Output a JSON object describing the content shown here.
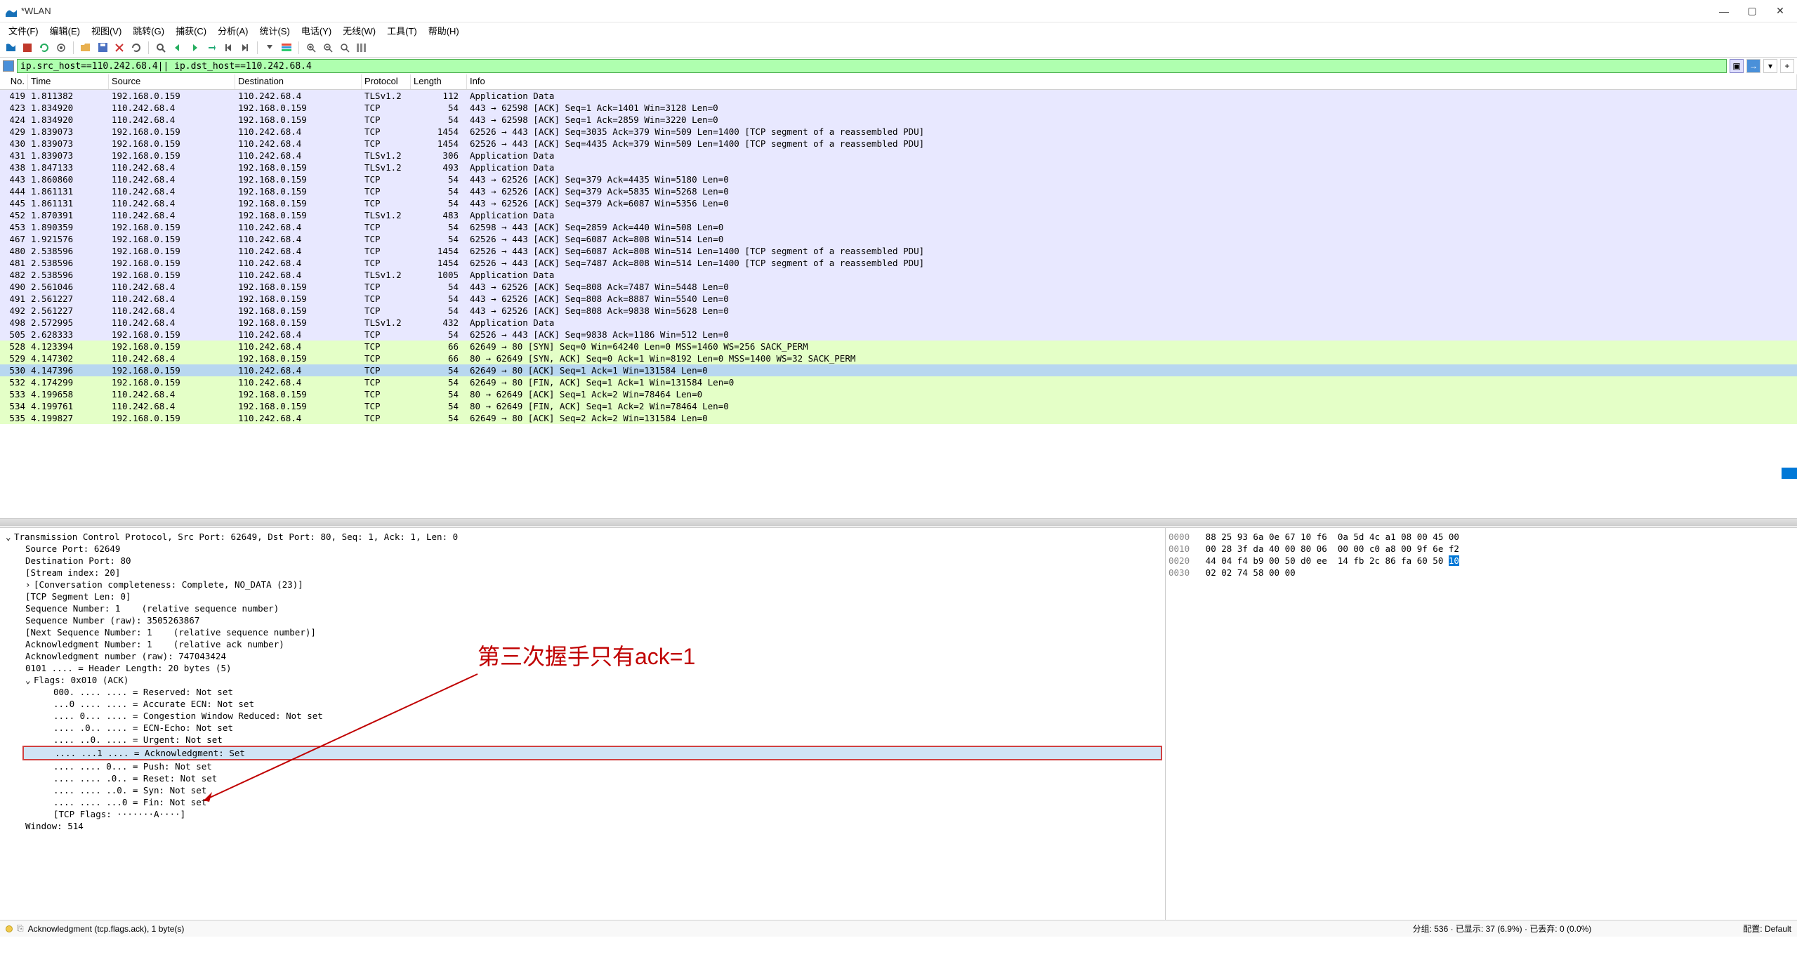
{
  "window": {
    "title": "*WLAN"
  },
  "menus": [
    "文件(F)",
    "编辑(E)",
    "视图(V)",
    "跳转(G)",
    "捕获(C)",
    "分析(A)",
    "统计(S)",
    "电话(Y)",
    "无线(W)",
    "工具(T)",
    "帮助(H)"
  ],
  "filter": {
    "value": "ip.src_host==110.242.68.4|| ip.dst_host==110.242.68.4"
  },
  "columns": [
    "No.",
    "Time",
    "Source",
    "Destination",
    "Protocol",
    "Length",
    "Info"
  ],
  "packets": [
    {
      "no": "419",
      "time": "1.811382",
      "src": "192.168.0.159",
      "dst": "110.242.68.4",
      "proto": "TLSv1.2",
      "len": "112",
      "info": "Application Data",
      "cls": "row-lavender"
    },
    {
      "no": "423",
      "time": "1.834920",
      "src": "110.242.68.4",
      "dst": "192.168.0.159",
      "proto": "TCP",
      "len": "54",
      "info": "443 → 62598 [ACK] Seq=1 Ack=1401 Win=3128 Len=0",
      "cls": "row-lavender"
    },
    {
      "no": "424",
      "time": "1.834920",
      "src": "110.242.68.4",
      "dst": "192.168.0.159",
      "proto": "TCP",
      "len": "54",
      "info": "443 → 62598 [ACK] Seq=1 Ack=2859 Win=3220 Len=0",
      "cls": "row-lavender"
    },
    {
      "no": "429",
      "time": "1.839073",
      "src": "192.168.0.159",
      "dst": "110.242.68.4",
      "proto": "TCP",
      "len": "1454",
      "info": "62526 → 443 [ACK] Seq=3035 Ack=379 Win=509 Len=1400 [TCP segment of a reassembled PDU]",
      "cls": "row-lavender"
    },
    {
      "no": "430",
      "time": "1.839073",
      "src": "192.168.0.159",
      "dst": "110.242.68.4",
      "proto": "TCP",
      "len": "1454",
      "info": "62526 → 443 [ACK] Seq=4435 Ack=379 Win=509 Len=1400 [TCP segment of a reassembled PDU]",
      "cls": "row-lavender"
    },
    {
      "no": "431",
      "time": "1.839073",
      "src": "192.168.0.159",
      "dst": "110.242.68.4",
      "proto": "TLSv1.2",
      "len": "306",
      "info": "Application Data",
      "cls": "row-lavender"
    },
    {
      "no": "438",
      "time": "1.847133",
      "src": "110.242.68.4",
      "dst": "192.168.0.159",
      "proto": "TLSv1.2",
      "len": "493",
      "info": "Application Data",
      "cls": "row-lavender"
    },
    {
      "no": "443",
      "time": "1.860860",
      "src": "110.242.68.4",
      "dst": "192.168.0.159",
      "proto": "TCP",
      "len": "54",
      "info": "443 → 62526 [ACK] Seq=379 Ack=4435 Win=5180 Len=0",
      "cls": "row-lavender"
    },
    {
      "no": "444",
      "time": "1.861131",
      "src": "110.242.68.4",
      "dst": "192.168.0.159",
      "proto": "TCP",
      "len": "54",
      "info": "443 → 62526 [ACK] Seq=379 Ack=5835 Win=5268 Len=0",
      "cls": "row-lavender"
    },
    {
      "no": "445",
      "time": "1.861131",
      "src": "110.242.68.4",
      "dst": "192.168.0.159",
      "proto": "TCP",
      "len": "54",
      "info": "443 → 62526 [ACK] Seq=379 Ack=6087 Win=5356 Len=0",
      "cls": "row-lavender"
    },
    {
      "no": "452",
      "time": "1.870391",
      "src": "110.242.68.4",
      "dst": "192.168.0.159",
      "proto": "TLSv1.2",
      "len": "483",
      "info": "Application Data",
      "cls": "row-lavender"
    },
    {
      "no": "453",
      "time": "1.890359",
      "src": "192.168.0.159",
      "dst": "110.242.68.4",
      "proto": "TCP",
      "len": "54",
      "info": "62598 → 443 [ACK] Seq=2859 Ack=440 Win=508 Len=0",
      "cls": "row-lavender"
    },
    {
      "no": "467",
      "time": "1.921576",
      "src": "192.168.0.159",
      "dst": "110.242.68.4",
      "proto": "TCP",
      "len": "54",
      "info": "62526 → 443 [ACK] Seq=6087 Ack=808 Win=514 Len=0",
      "cls": "row-lavender"
    },
    {
      "no": "480",
      "time": "2.538596",
      "src": "192.168.0.159",
      "dst": "110.242.68.4",
      "proto": "TCP",
      "len": "1454",
      "info": "62526 → 443 [ACK] Seq=6087 Ack=808 Win=514 Len=1400 [TCP segment of a reassembled PDU]",
      "cls": "row-lavender"
    },
    {
      "no": "481",
      "time": "2.538596",
      "src": "192.168.0.159",
      "dst": "110.242.68.4",
      "proto": "TCP",
      "len": "1454",
      "info": "62526 → 443 [ACK] Seq=7487 Ack=808 Win=514 Len=1400 [TCP segment of a reassembled PDU]",
      "cls": "row-lavender"
    },
    {
      "no": "482",
      "time": "2.538596",
      "src": "192.168.0.159",
      "dst": "110.242.68.4",
      "proto": "TLSv1.2",
      "len": "1005",
      "info": "Application Data",
      "cls": "row-lavender"
    },
    {
      "no": "490",
      "time": "2.561046",
      "src": "110.242.68.4",
      "dst": "192.168.0.159",
      "proto": "TCP",
      "len": "54",
      "info": "443 → 62526 [ACK] Seq=808 Ack=7487 Win=5448 Len=0",
      "cls": "row-lavender"
    },
    {
      "no": "491",
      "time": "2.561227",
      "src": "110.242.68.4",
      "dst": "192.168.0.159",
      "proto": "TCP",
      "len": "54",
      "info": "443 → 62526 [ACK] Seq=808 Ack=8887 Win=5540 Len=0",
      "cls": "row-lavender"
    },
    {
      "no": "492",
      "time": "2.561227",
      "src": "110.242.68.4",
      "dst": "192.168.0.159",
      "proto": "TCP",
      "len": "54",
      "info": "443 → 62526 [ACK] Seq=808 Ack=9838 Win=5628 Len=0",
      "cls": "row-lavender"
    },
    {
      "no": "498",
      "time": "2.572995",
      "src": "110.242.68.4",
      "dst": "192.168.0.159",
      "proto": "TLSv1.2",
      "len": "432",
      "info": "Application Data",
      "cls": "row-lavender"
    },
    {
      "no": "505",
      "time": "2.628333",
      "src": "192.168.0.159",
      "dst": "110.242.68.4",
      "proto": "TCP",
      "len": "54",
      "info": "62526 → 443 [ACK] Seq=9838 Ack=1186 Win=512 Len=0",
      "cls": "row-lavender"
    },
    {
      "no": "528",
      "time": "4.123394",
      "src": "192.168.0.159",
      "dst": "110.242.68.4",
      "proto": "TCP",
      "len": "66",
      "info": "62649 → 80 [SYN] Seq=0 Win=64240 Len=0 MSS=1460 WS=256 SACK_PERM",
      "cls": "row-green"
    },
    {
      "no": "529",
      "time": "4.147302",
      "src": "110.242.68.4",
      "dst": "192.168.0.159",
      "proto": "TCP",
      "len": "66",
      "info": "80 → 62649 [SYN, ACK] Seq=0 Ack=1 Win=8192 Len=0 MSS=1400 WS=32 SACK_PERM",
      "cls": "row-green"
    },
    {
      "no": "530",
      "time": "4.147396",
      "src": "192.168.0.159",
      "dst": "110.242.68.4",
      "proto": "TCP",
      "len": "54",
      "info": "62649 → 80 [ACK] Seq=1 Ack=1 Win=131584 Len=0",
      "cls": "row-selected"
    },
    {
      "no": "532",
      "time": "4.174299",
      "src": "192.168.0.159",
      "dst": "110.242.68.4",
      "proto": "TCP",
      "len": "54",
      "info": "62649 → 80 [FIN, ACK] Seq=1 Ack=1 Win=131584 Len=0",
      "cls": "row-green"
    },
    {
      "no": "533",
      "time": "4.199658",
      "src": "110.242.68.4",
      "dst": "192.168.0.159",
      "proto": "TCP",
      "len": "54",
      "info": "80 → 62649 [ACK] Seq=1 Ack=2 Win=78464 Len=0",
      "cls": "row-green"
    },
    {
      "no": "534",
      "time": "4.199761",
      "src": "110.242.68.4",
      "dst": "192.168.0.159",
      "proto": "TCP",
      "len": "54",
      "info": "80 → 62649 [FIN, ACK] Seq=1 Ack=2 Win=78464 Len=0",
      "cls": "row-green"
    },
    {
      "no": "535",
      "time": "4.199827",
      "src": "192.168.0.159",
      "dst": "110.242.68.4",
      "proto": "TCP",
      "len": "54",
      "info": "62649 → 80 [ACK] Seq=2 Ack=2 Win=131584 Len=0",
      "cls": "row-green"
    }
  ],
  "details": {
    "header": "Transmission Control Protocol, Src Port: 62649, Dst Port: 80, Seq: 1, Ack: 1, Len: 0",
    "lines": [
      "Source Port: 62649",
      "Destination Port: 80",
      "[Stream index: 20]",
      "[Conversation completeness: Complete, NO_DATA (23)]",
      "[TCP Segment Len: 0]",
      "Sequence Number: 1    (relative sequence number)",
      "Sequence Number (raw): 3505263867",
      "[Next Sequence Number: 1    (relative sequence number)]",
      "Acknowledgment Number: 1    (relative ack number)",
      "Acknowledgment number (raw): 747043424",
      "0101 .... = Header Length: 20 bytes (5)"
    ],
    "flags_header": "Flags: 0x010 (ACK)",
    "flags": [
      "000. .... .... = Reserved: Not set",
      "...0 .... .... = Accurate ECN: Not set",
      ".... 0... .... = Congestion Window Reduced: Not set",
      ".... .0.. .... = ECN-Echo: Not set",
      ".... ..0. .... = Urgent: Not set"
    ],
    "ack_flag": ".... ...1 .... = Acknowledgment: Set",
    "flags_after": [
      ".... .... 0... = Push: Not set",
      ".... .... .0.. = Reset: Not set",
      ".... .... ..0. = Syn: Not set",
      ".... .... ...0 = Fin: Not set",
      "[TCP Flags: ·······A····]"
    ],
    "window": "Window: 514"
  },
  "hex": [
    {
      "off": "0000",
      "bytes": "88 25 93 6a 0e 67 10 f6  0a 5d 4c a1 08 00 45 00"
    },
    {
      "off": "0010",
      "bytes": "00 28 3f da 40 00 80 06  00 00 c0 a8 00 9f 6e f2"
    },
    {
      "off": "0020",
      "bytes": "44 04 f4 b9 00 50 d0 ee  14 fb 2c 86 fa 60 50 "
    },
    {
      "off": "0030",
      "bytes": "02 02 74 58 00 00"
    }
  ],
  "hex_sel": "10",
  "annotation": "第三次握手只有ack=1",
  "statusbar": {
    "left": "Acknowledgment (tcp.flags.ack), 1 byte(s)",
    "right_packets": "分组: 536 · 已显示: 37 (6.9%) · 已丢弃: 0 (0.0%)",
    "profile": "配置: Default"
  }
}
